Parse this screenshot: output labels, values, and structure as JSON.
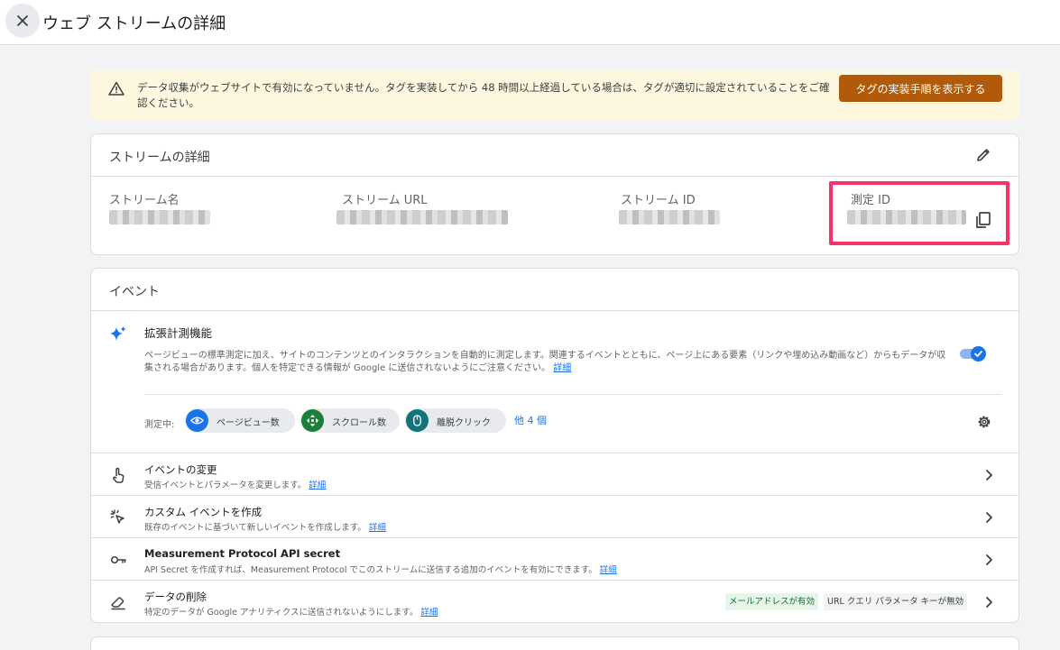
{
  "header": {
    "title": "ウェブ ストリームの詳細"
  },
  "banner": {
    "text": "データ収集がウェブサイトで有効になっていません。タグを実装してから 48 時間以上経過している場合は、タグが適切に設定されていることをご確認ください。",
    "button_label": "タグの実装手順を表示する",
    "colors": {
      "background": "#fef7e0",
      "button": "#b05a0a"
    }
  },
  "stream_details": {
    "title": "ストリームの詳細",
    "fields": [
      {
        "label": "ストリーム名"
      },
      {
        "label": "ストリーム URL"
      },
      {
        "label": "ストリーム ID"
      },
      {
        "label": "測定 ID"
      }
    ],
    "highlight_color": "#f4336b"
  },
  "events": {
    "title": "イベント",
    "enhanced": {
      "title": "拡張計測機能",
      "description": "ページビューの標準測定に加え、サイトのコンテンツとのインタラクションを自動的に測定します。関連するイベントとともに、ページ上にある要素（リンクや埋め込み動画など）からもデータが収集される場合があります。個人を特定できる情報が Google に送信されないようにご注意ください。",
      "details_link": "詳細",
      "measuring_label": "測定中:",
      "chips": [
        {
          "label": "ページビュー数",
          "icon": "eye-icon",
          "color": "#1a73e8"
        },
        {
          "label": "スクロール数",
          "icon": "scroll-icon",
          "color": "#188038"
        },
        {
          "label": "離脱クリック",
          "icon": "mouse-icon",
          "color": "#12737b"
        }
      ],
      "more_link": "他 4 個"
    },
    "rows": [
      {
        "title": "イベントの変更",
        "subtitle": "受信イベントとパラメータを変更します。",
        "link": "詳細",
        "icon": "touch-icon"
      },
      {
        "title": "カスタム イベントを作成",
        "subtitle": "既存のイベントに基づいて新しいイベントを作成します。",
        "link": "詳細",
        "icon": "click-sparkle-icon"
      },
      {
        "title": "Measurement Protocol API secret",
        "subtitle": "API Secret を作成すれば、Measurement Protocol でこのストリームに送信する追加のイベントを有効にできます。",
        "link": "詳細",
        "icon": "key-icon"
      },
      {
        "title": "データの削除",
        "subtitle": "特定のデータが Google アナリティクスに送信されないようにします。",
        "link": "詳細",
        "icon": "eraser-icon",
        "badges": [
          "メールアドレスが有効",
          "URL クエリ パラメータ キーが無効"
        ]
      }
    ]
  }
}
